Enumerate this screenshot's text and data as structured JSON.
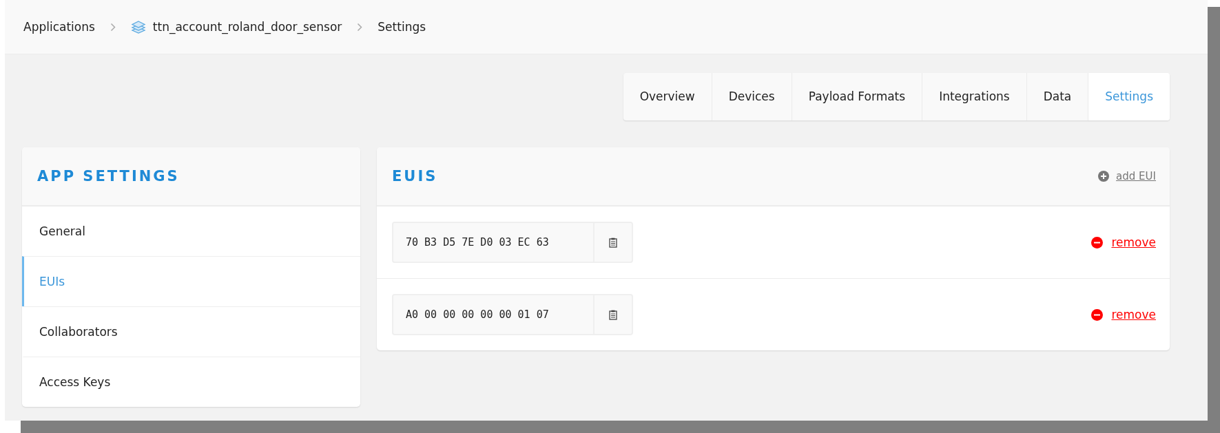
{
  "breadcrumb": [
    {
      "label": "Applications",
      "kind": "link"
    },
    {
      "label": "ttn_account_roland_door_sensor",
      "kind": "app"
    },
    {
      "label": "Settings",
      "kind": "current"
    }
  ],
  "tabs": [
    {
      "label": "Overview",
      "selected": false
    },
    {
      "label": "Devices",
      "selected": false
    },
    {
      "label": "Payload Formats",
      "selected": false
    },
    {
      "label": "Integrations",
      "selected": false
    },
    {
      "label": "Data",
      "selected": false
    },
    {
      "label": "Settings",
      "selected": true
    }
  ],
  "sidebar": {
    "title": "APP SETTINGS",
    "items": [
      {
        "label": "General",
        "selected": false
      },
      {
        "label": "EUIs",
        "selected": true
      },
      {
        "label": "Collaborators",
        "selected": false
      },
      {
        "label": "Access Keys",
        "selected": false
      }
    ]
  },
  "euis_panel": {
    "title": "EUIS",
    "add_link": "add EUI",
    "rows": [
      {
        "eui": "70 B3 D5 7E D0 03 EC 63",
        "remove_link": "remove"
      },
      {
        "eui": "A0 00 00 00 00 00 01 07",
        "remove_link": "remove"
      }
    ]
  }
}
